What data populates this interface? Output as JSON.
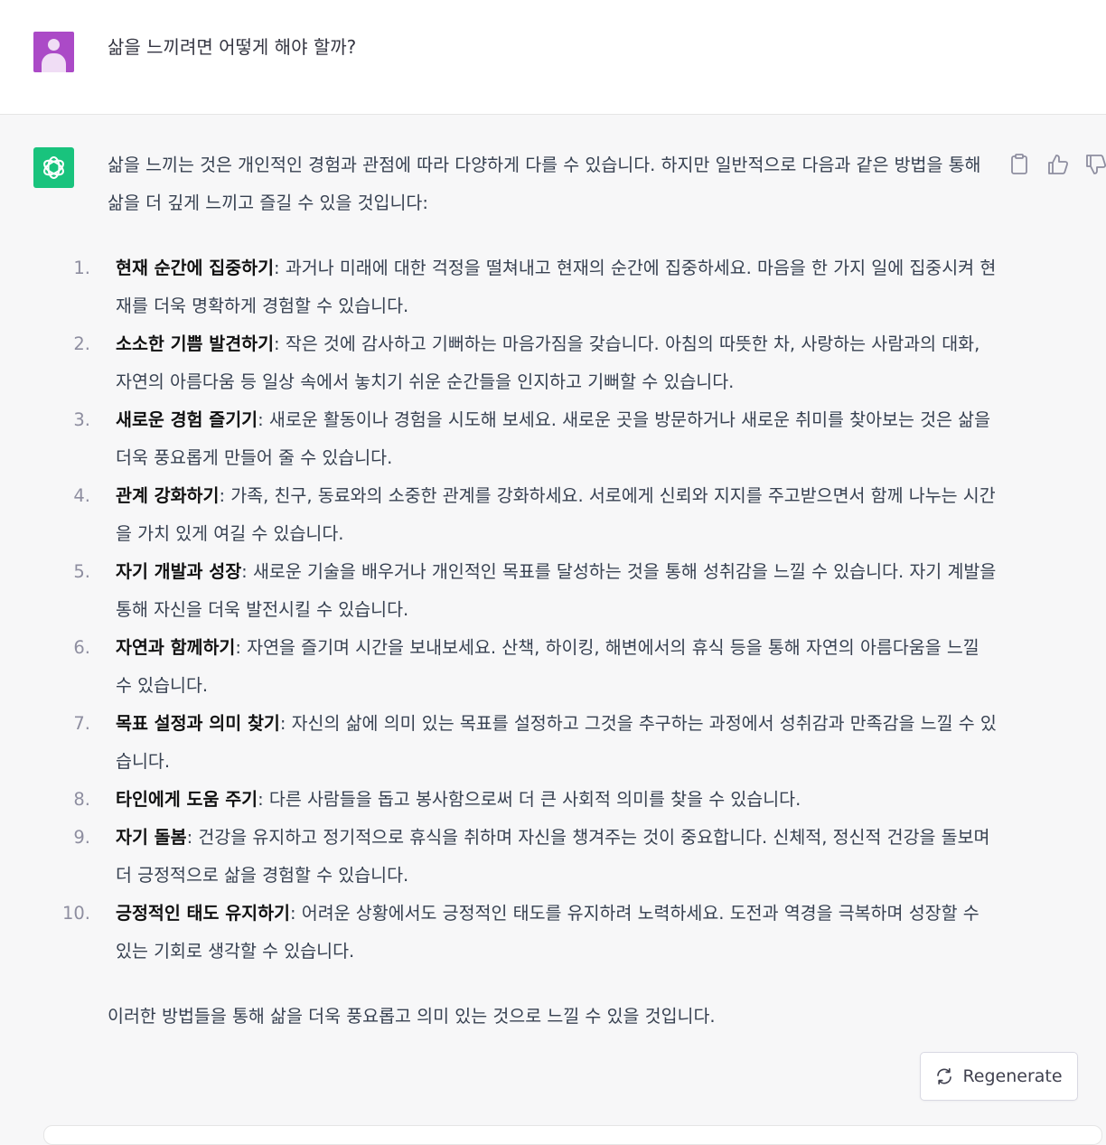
{
  "user_message": {
    "text": "삶을 느끼려면 어떻게 해야 할까?",
    "avatar_icon": "user-icon",
    "avatar_color": "#ab4ac7"
  },
  "assistant_message": {
    "avatar_icon": "openai-logo-icon",
    "avatar_color": "#19c37d",
    "intro": "삶을 느끼는 것은 개인적인 경험과 관점에 따라 다양하게 다를 수 있습니다. 하지만 일반적으로 다음과 같은 방법을 통해 삶을 더 깊게 느끼고 즐길 수 있을 것입니다:",
    "items": [
      {
        "num": "1.",
        "title": "현재 순간에 집중하기",
        "text": ": 과거나 미래에 대한 걱정을 떨쳐내고 현재의 순간에 집중하세요. 마음을 한 가지 일에 집중시켜 현재를 더욱 명확하게 경험할 수 있습니다."
      },
      {
        "num": "2.",
        "title": "소소한 기쁨 발견하기",
        "text": ": 작은 것에 감사하고 기뻐하는 마음가짐을 갖습니다. 아침의 따뜻한 차, 사랑하는 사람과의 대화, 자연의 아름다움 등 일상 속에서 놓치기 쉬운 순간들을 인지하고 기뻐할 수 있습니다."
      },
      {
        "num": "3.",
        "title": "새로운 경험 즐기기",
        "text": ": 새로운 활동이나 경험을 시도해 보세요. 새로운 곳을 방문하거나 새로운 취미를 찾아보는 것은 삶을 더욱 풍요롭게 만들어 줄 수 있습니다."
      },
      {
        "num": "4.",
        "title": "관계 강화하기",
        "text": ": 가족, 친구, 동료와의 소중한 관계를 강화하세요. 서로에게 신뢰와 지지를 주고받으면서 함께 나누는 시간을 가치 있게 여길 수 있습니다."
      },
      {
        "num": "5.",
        "title": "자기 개발과 성장",
        "text": ": 새로운 기술을 배우거나 개인적인 목표를 달성하는 것을 통해 성취감을 느낄 수 있습니다. 자기 계발을 통해 자신을 더욱 발전시킬 수 있습니다."
      },
      {
        "num": "6.",
        "title": "자연과 함께하기",
        "text": ": 자연을 즐기며 시간을 보내보세요. 산책, 하이킹, 해변에서의 휴식 등을 통해 자연의 아름다움을 느낄 수 있습니다."
      },
      {
        "num": "7.",
        "title": "목표 설정과 의미 찾기",
        "text": ": 자신의 삶에 의미 있는 목표를 설정하고 그것을 추구하는 과정에서 성취감과 만족감을 느낄 수 있습니다."
      },
      {
        "num": "8.",
        "title": "타인에게 도움 주기",
        "text": ": 다른 사람들을 돕고 봉사함으로써 더 큰 사회적 의미를 찾을 수 있습니다."
      },
      {
        "num": "9.",
        "title": "자기 돌봄",
        "text": ": 건강을 유지하고 정기적으로 휴식을 취하며 자신을 챙겨주는 것이 중요합니다. 신체적, 정신적 건강을 돌보며 더 긍정적으로 삶을 경험할 수 있습니다."
      },
      {
        "num": "10.",
        "title": "긍정적인 태도 유지하기",
        "text": ": 어려운 상황에서도 긍정적인 태도를 유지하려 노력하세요. 도전과 역경을 극복하며 성장할 수 있는 기회로 생각할 수 있습니다."
      }
    ],
    "closing": "이러한 방법들을 통해 삶을 더욱 풍요롭고 의미 있는 것으로 느낄 수 있을 것입니다."
  },
  "message_actions": [
    "clipboard-icon",
    "thumbs-up-icon",
    "thumbs-down-icon"
  ],
  "regenerate_button": {
    "label": "Regenerate",
    "icon": "refresh-icon"
  }
}
